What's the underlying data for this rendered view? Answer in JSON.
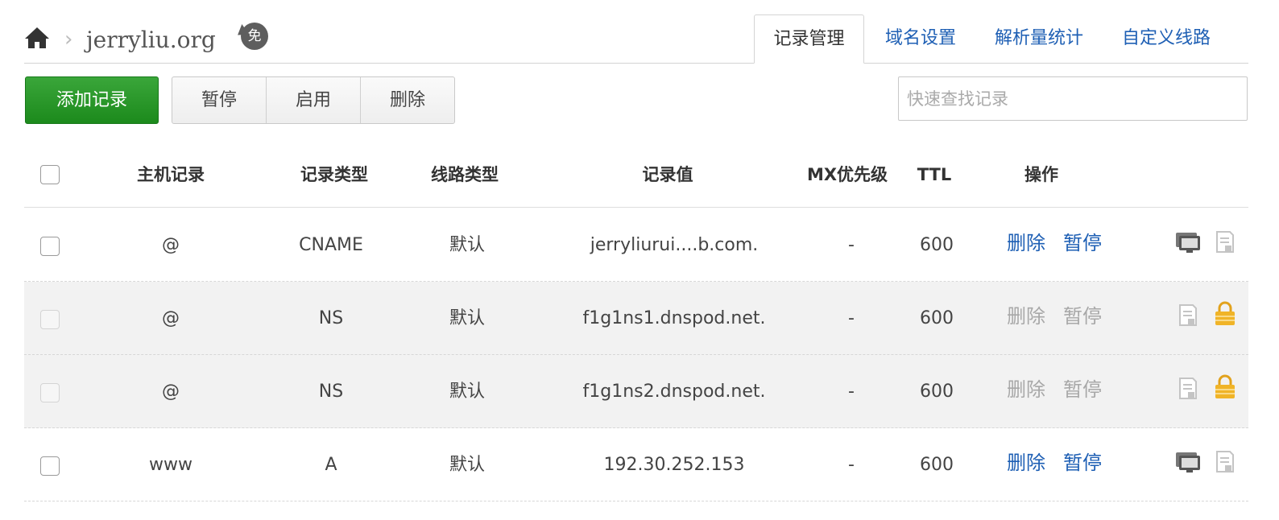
{
  "header": {
    "domain": "jerryliu.org",
    "breadcrumb_sep": "›",
    "free_badge": "免"
  },
  "tabs": [
    {
      "label": "记录管理",
      "active": true
    },
    {
      "label": "域名设置",
      "active": false
    },
    {
      "label": "解析量统计",
      "active": false
    },
    {
      "label": "自定义线路",
      "active": false
    }
  ],
  "toolbar": {
    "add_label": "添加记录",
    "pause_label": "暂停",
    "enable_label": "启用",
    "delete_label": "删除",
    "search_placeholder": "快速查找记录"
  },
  "table": {
    "headers": [
      "主机记录",
      "记录类型",
      "线路类型",
      "记录值",
      "MX优先级",
      "TTL",
      "操作"
    ],
    "rows": [
      {
        "host": "@",
        "type": "CNAME",
        "line": "默认",
        "value": "jerryliurui....b.com.",
        "mx": "-",
        "ttl": "600",
        "delete": "删除",
        "pause": "暂停",
        "locked": false
      },
      {
        "host": "@",
        "type": "NS",
        "line": "默认",
        "value": "f1g1ns1.dnspod.net.",
        "mx": "-",
        "ttl": "600",
        "delete": "删除",
        "pause": "暂停",
        "locked": true
      },
      {
        "host": "@",
        "type": "NS",
        "line": "默认",
        "value": "f1g1ns2.dnspod.net.",
        "mx": "-",
        "ttl": "600",
        "delete": "删除",
        "pause": "暂停",
        "locked": true
      },
      {
        "host": "www",
        "type": "A",
        "line": "默认",
        "value": "192.30.252.153",
        "mx": "-",
        "ttl": "600",
        "delete": "删除",
        "pause": "暂停",
        "locked": false
      }
    ]
  },
  "colors": {
    "link": "#1e5fb4",
    "add_button": "#2a982a",
    "lock": "#f0b428",
    "disabled": "#a8a8a8"
  },
  "icons": {
    "home": "home-icon",
    "monitor": "monitor-icon",
    "note": "note-icon",
    "lock": "lock-icon"
  }
}
